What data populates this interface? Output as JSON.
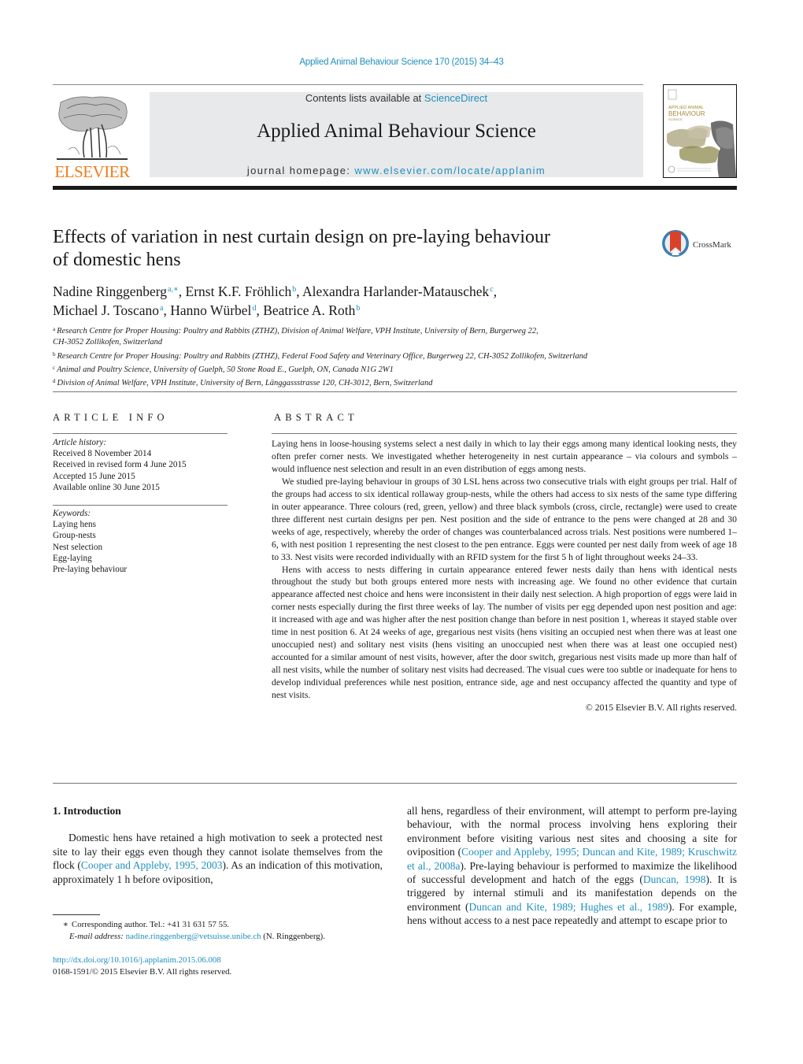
{
  "header": {
    "journal_reference": "Applied Animal Behaviour Science 170 (2015) 34–43",
    "contents_prefix": "Contents lists available at ",
    "contents_link": "ScienceDirect",
    "journal_title": "Applied Animal Behaviour Science",
    "homepage_prefix": "journal homepage: ",
    "homepage_link": "www.elsevier.com/locate/applanim",
    "publisher_logo_text": "ELSEVIER",
    "cover_title_line1": "APPLIED ANIMAL",
    "cover_title_line2": "BEHAVIOUR",
    "cover_title_line3": "SCIENCE",
    "crossmark_label": "CrossMark"
  },
  "colors": {
    "link": "#1f8fbf",
    "elsevier_orange": "#f07d1b",
    "banner_gray": "#e8e9ea",
    "crossmark_red": "#d9412b",
    "crossmark_blue": "#3b7fb0"
  },
  "article": {
    "title_line1": "Effects of variation in nest curtain design on pre-laying behaviour",
    "title_line2": "of domestic hens",
    "authors": [
      {
        "name": "Nadine Ringgenberg",
        "sup": "a,∗",
        "sep": ", "
      },
      {
        "name": "Ernst K.F. Fröhlich",
        "sup": "b",
        "sep": ", "
      },
      {
        "name": "Alexandra Harlander-Matauschek",
        "sup": "c",
        "sep": ","
      },
      {
        "name": "Michael J. Toscano",
        "sup": "a",
        "sep": ", "
      },
      {
        "name": "Hanno Würbel",
        "sup": "d",
        "sep": ", "
      },
      {
        "name": "Beatrice A. Roth",
        "sup": "b",
        "sep": ""
      }
    ],
    "affiliations": [
      {
        "key": "a",
        "text": "Research Centre for Proper Housing: Poultry and Rabbits (ZTHZ), Division of Animal Welfare, VPH Institute, University of Bern, Burgerweg 22,",
        "text2": "CH-3052 Zollikofen, Switzerland"
      },
      {
        "key": "b",
        "text": "Research Centre for Proper Housing: Poultry and Rabbits (ZTHZ), Federal Food Safety and Veterinary Office, Burgerweg 22, CH-3052 Zollikofen, Switzerland"
      },
      {
        "key": "c",
        "text": "Animal and Poultry Science, University of Guelph, 50 Stone Road E., Guelph, ON, Canada N1G 2W1"
      },
      {
        "key": "d",
        "text": "Division of Animal Welfare, VPH Institute, University of Bern, Länggassstrasse 120, CH-3012, Bern, Switzerland"
      }
    ]
  },
  "article_info": {
    "heading": "ARTICLE INFO",
    "history_label": "Article history:",
    "history": [
      "Received 8 November 2014",
      "Received in revised form 4 June 2015",
      "Accepted 15 June 2015",
      "Available online 30 June 2015"
    ],
    "keywords_label": "Keywords:",
    "keywords": [
      "Laying hens",
      "Group-nests",
      "Nest selection",
      "Egg-laying",
      "Pre-laying behaviour"
    ]
  },
  "abstract": {
    "heading": "ABSTRACT",
    "paragraphs": [
      "Laying hens in loose-housing systems select a nest daily in which to lay their eggs among many identical looking nests, they often prefer corner nests. We investigated whether heterogeneity in nest curtain appearance – via colours and symbols – would influence nest selection and result in an even distribution of eggs among nests.",
      "We studied pre-laying behaviour in groups of 30 LSL hens across two consecutive trials with eight groups per trial. Half of the groups had access to six identical rollaway group-nests, while the others had access to six nests of the same type differing in outer appearance. Three colours (red, green, yellow) and three black symbols (cross, circle, rectangle) were used to create three different nest curtain designs per pen. Nest position and the side of entrance to the pens were changed at 28 and 30 weeks of age, respectively, whereby the order of changes was counterbalanced across trials. Nest positions were numbered 1–6, with nest position 1 representing the nest closest to the pen entrance. Eggs were counted per nest daily from week of age 18 to 33. Nest visits were recorded individually with an RFID system for the first 5 h of light throughout weeks 24–33.",
      "Hens with access to nests differing in curtain appearance entered fewer nests daily than hens with identical nests throughout the study but both groups entered more nests with increasing age. We found no other evidence that curtain appearance affected nest choice and hens were inconsistent in their daily nest selection. A high proportion of eggs were laid in corner nests especially during the first three weeks of lay. The number of visits per egg depended upon nest position and age: it increased with age and was higher after the nest position change than before in nest position 1, whereas it stayed stable over time in nest position 6. At 24 weeks of age, gregarious nest visits (hens visiting an occupied nest when there was at least one unoccupied nest) and solitary nest visits (hens visiting an unoccupied nest when there was at least one occupied nest) accounted for a similar amount of nest visits, however, after the door switch, gregarious nest visits made up more than half of all nest visits, while the number of solitary nest visits had decreased. The visual cues were too subtle or inadequate for hens to develop individual preferences while nest position, entrance side, age and nest occupancy affected the quantity and type of nest visits."
    ],
    "copyright": "© 2015 Elsevier B.V. All rights reserved."
  },
  "body": {
    "intro_heading": "1.  Introduction",
    "left_p1_a": "Domestic hens have retained a high motivation to seek a protected nest site to lay their eggs even though they cannot isolate themselves from the flock (",
    "left_p1_cite1": "Cooper and Appleby, 1995, 2003",
    "left_p1_b": "). As an indication of this motivation, approximately 1 h before oviposition,",
    "right_a": "all hens, regardless of their environment, will attempt to perform pre-laying behaviour, with the normal process involving hens exploring their environment before visiting various nest sites and choosing a site for oviposition (",
    "right_cite1": "Cooper and Appleby, 1995; Duncan and Kite, 1989; Kruschwitz et al., 2008a",
    "right_b": "). Pre-laying behaviour is performed to maximize the likelihood of successful development and hatch of the eggs (",
    "right_cite2": "Duncan, 1998",
    "right_c": "). It is triggered by internal stimuli and its manifestation depends on the environment (",
    "right_cite3": "Duncan and Kite, 1989; Hughes et al., 1989",
    "right_d": "). For example, hens without access to a nest pace repeatedly and attempt to escape prior to"
  },
  "footnote": {
    "star": "∗",
    "corresponding": "Corresponding author. Tel.: +41 31 631 57 55.",
    "email_label": "E-mail address: ",
    "email": "nadine.ringgenberg@vetsuisse.unibe.ch",
    "email_suffix": " (N. Ringgenberg).",
    "doi": "http://dx.doi.org/10.1016/j.applanim.2015.06.008",
    "issn_line": "0168-1591/© 2015 Elsevier B.V. All rights reserved."
  }
}
